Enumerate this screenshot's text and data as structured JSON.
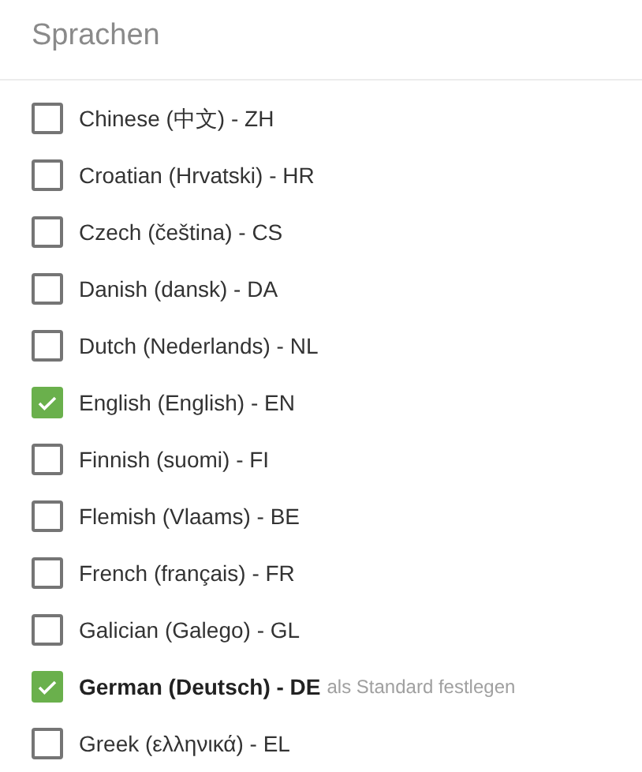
{
  "title": "Sprachen",
  "languages": [
    {
      "label": "Chinese (中文) - ZH",
      "checked": false,
      "hovered": false
    },
    {
      "label": "Croatian (Hrvatski) - HR",
      "checked": false,
      "hovered": false
    },
    {
      "label": "Czech (čeština) - CS",
      "checked": false,
      "hovered": false
    },
    {
      "label": "Danish (dansk) - DA",
      "checked": false,
      "hovered": false
    },
    {
      "label": "Dutch (Nederlands) - NL",
      "checked": false,
      "hovered": false
    },
    {
      "label": "English (English) - EN",
      "checked": true,
      "hovered": false
    },
    {
      "label": "Finnish (suomi) - FI",
      "checked": false,
      "hovered": false
    },
    {
      "label": "Flemish (Vlaams) - BE",
      "checked": false,
      "hovered": false
    },
    {
      "label": "French (français) - FR",
      "checked": false,
      "hovered": false
    },
    {
      "label": "Galician (Galego) - GL",
      "checked": false,
      "hovered": false
    },
    {
      "label": "German (Deutsch) - DE",
      "checked": true,
      "hovered": true,
      "action": "als Standard festlegen"
    },
    {
      "label": "Greek (ελληνικά) - EL",
      "checked": false,
      "hovered": false
    }
  ]
}
